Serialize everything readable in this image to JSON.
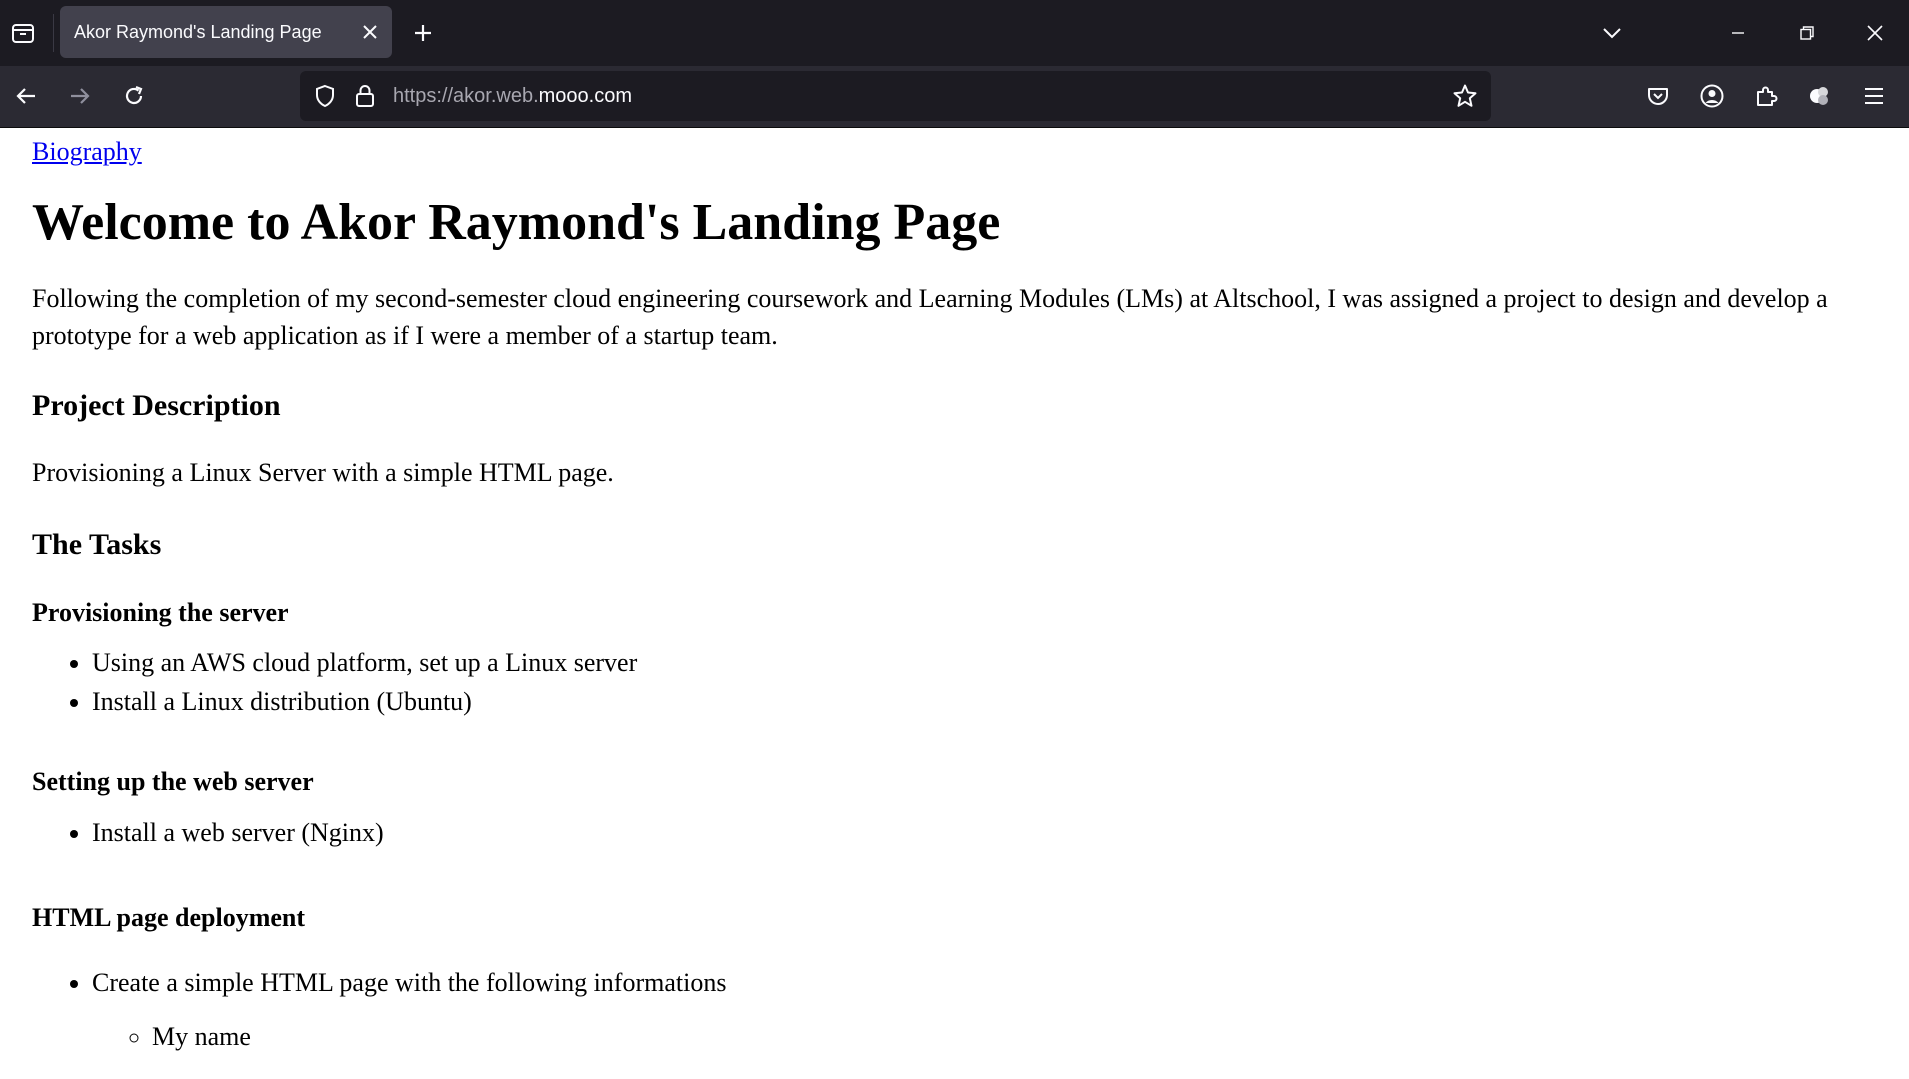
{
  "browser": {
    "tab_title": "Akor Raymond's Landing Page",
    "url_dim": "https://akor.web.",
    "url_main": "mooo.com"
  },
  "page": {
    "biography_link": "Biography",
    "heading": "Welcome to Akor Raymond's Landing Page",
    "intro": "Following the completion of my second-semester cloud engineering coursework and Learning Modules (LMs) at Altschool, I was assigned a project to design and develop a prototype for a web application as if I were a member of a startup team.",
    "project_description_heading": "Project Description",
    "project_description": "Provisioning a Linux Server with a simple HTML page.",
    "tasks_heading": "The Tasks",
    "provisioning_heading": "Provisioning the server",
    "provisioning_items": [
      "Using an AWS cloud platform, set up a Linux server",
      "Install a Linux distribution (Ubuntu)"
    ],
    "webserver_heading": "Setting up the web server",
    "webserver_items": [
      "Install a web server (Nginx)"
    ],
    "deployment_heading": "HTML page deployment",
    "deployment_items": [
      "Create a simple HTML page with the following informations"
    ],
    "deployment_subitems": [
      "My name"
    ]
  }
}
